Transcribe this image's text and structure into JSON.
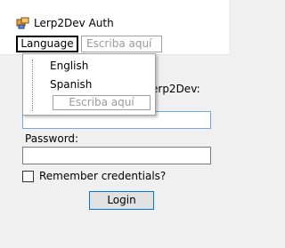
{
  "window": {
    "title": "Lerp2Dev Auth",
    "icon": "app-icon"
  },
  "menubar": {
    "language_label": "Language",
    "textbox_placeholder": "Escriba aquí"
  },
  "dropdown": {
    "items": [
      "English",
      "Spanish"
    ],
    "textbox_placeholder": "Escriba aquí"
  },
  "form": {
    "info_label_visible": "erp2Dev:",
    "password_label": "Password:",
    "remember_label": "Remember credentials?",
    "login_label": "Login"
  },
  "colors": {
    "accent": "#0078d7",
    "focus_border": "#7aa7d9",
    "placeholder": "#9b9b9b"
  }
}
